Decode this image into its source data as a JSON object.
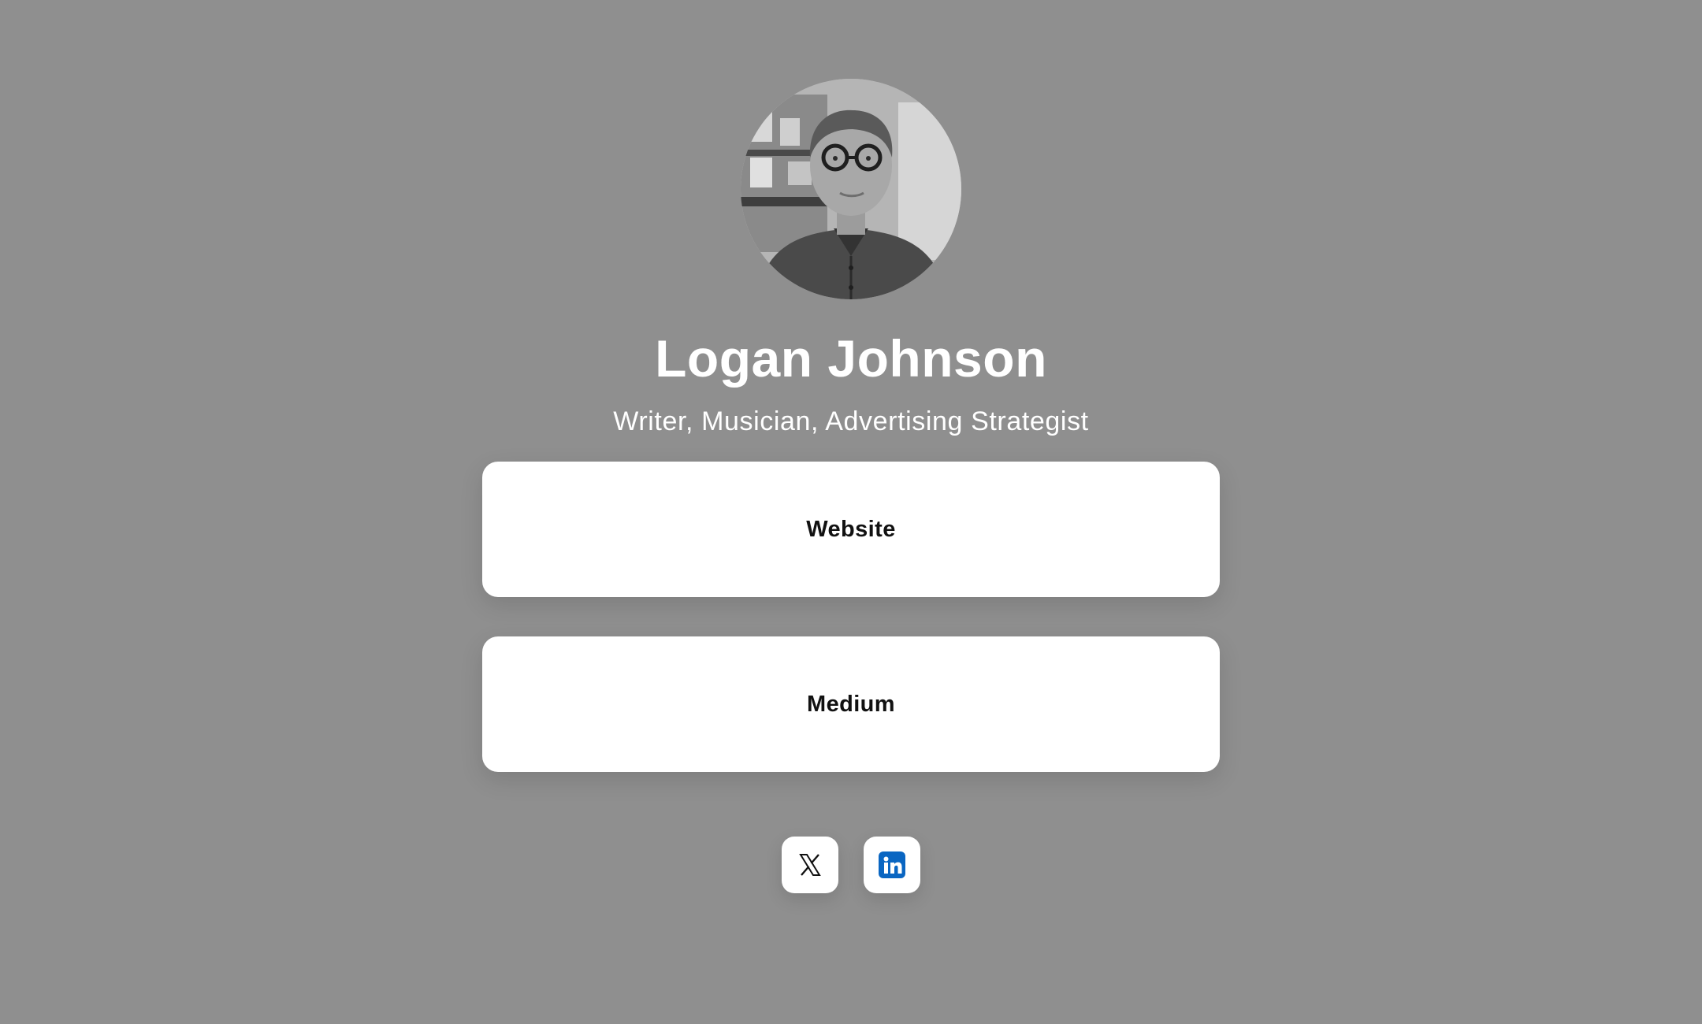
{
  "profile": {
    "name": "Logan Johnson",
    "tagline": "Writer, Musician, Advertising Strategist"
  },
  "links": [
    {
      "label": "Website"
    },
    {
      "label": "Medium"
    }
  ],
  "socials": [
    {
      "icon": "x-icon"
    },
    {
      "icon": "linkedin-icon",
      "color": "#0a66c2"
    }
  ],
  "colors": {
    "background": "#8f8f8f",
    "card": "#ffffff",
    "text_on_bg": "#ffffff",
    "card_text": "#111111"
  }
}
